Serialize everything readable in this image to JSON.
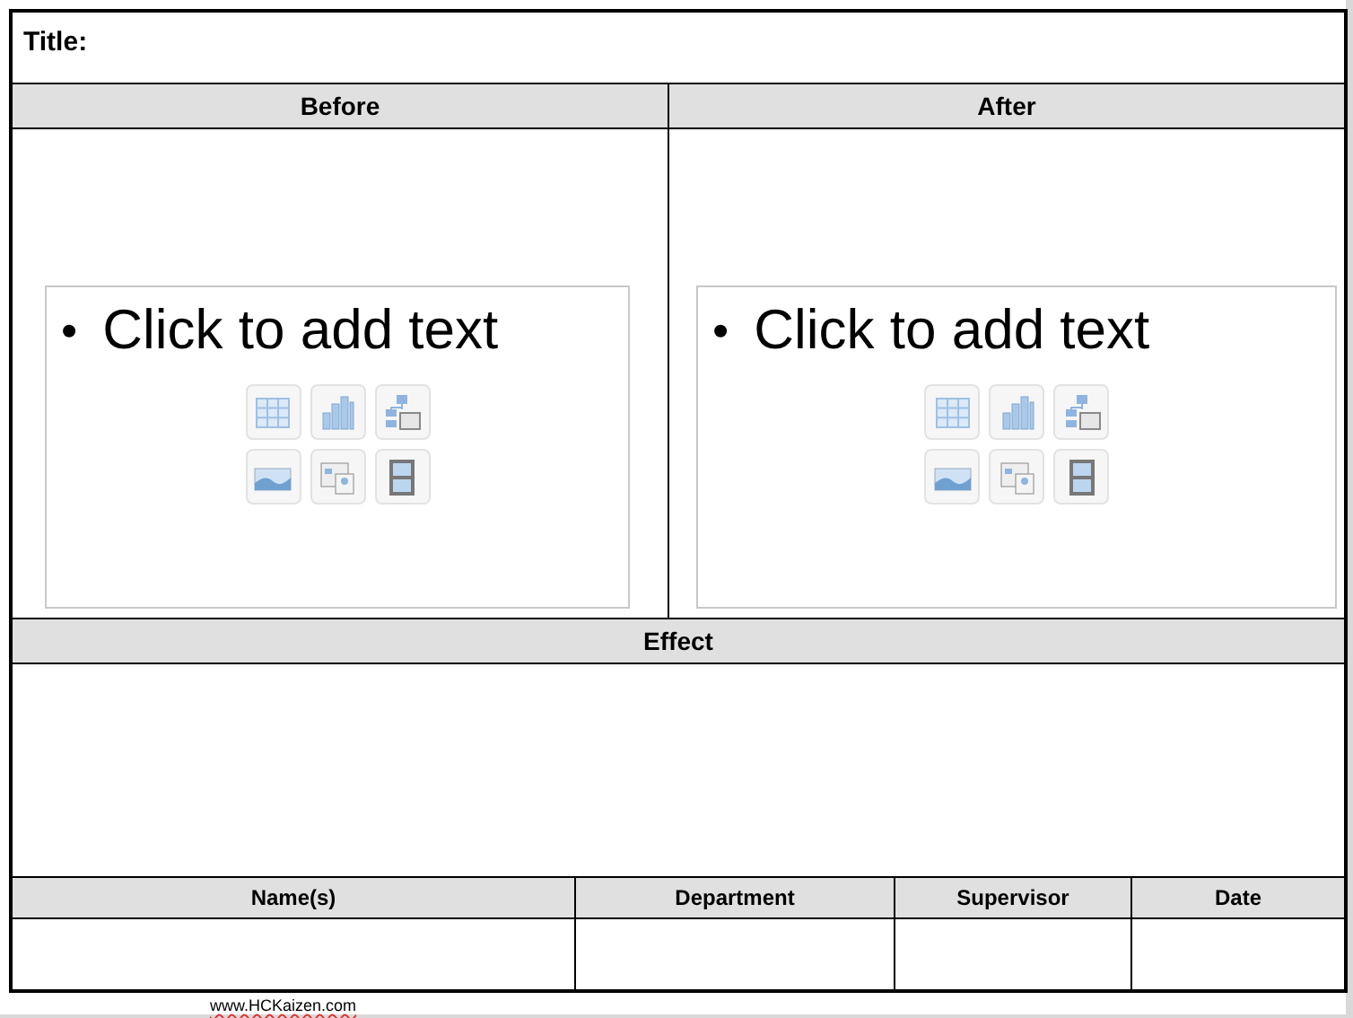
{
  "title_label": "Title:",
  "panels": [
    {
      "heading": "Before",
      "bullet": "•",
      "placeholder": "Click to add text"
    },
    {
      "heading": "After",
      "bullet": "•",
      "placeholder": "Click to add text"
    }
  ],
  "effect": {
    "heading": "Effect"
  },
  "signoff": {
    "columns": [
      "Name(s)",
      "Department",
      "Supervisor",
      "Date"
    ]
  },
  "footer": {
    "url": "www.HCKaizen.com"
  }
}
